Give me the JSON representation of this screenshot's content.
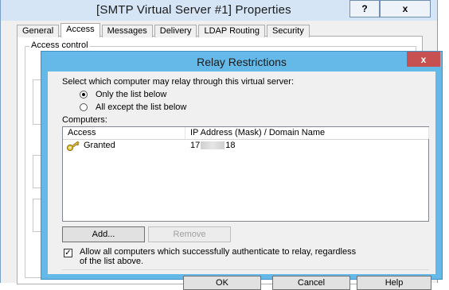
{
  "parent_window": {
    "title": "[SMTP Virtual Server #1] Properties",
    "help_button": "?",
    "close_button": "x",
    "tabs": [
      {
        "label": "General"
      },
      {
        "label": "Access"
      },
      {
        "label": "Messages"
      },
      {
        "label": "Delivery"
      },
      {
        "label": "LDAP Routing"
      },
      {
        "label": "Security"
      }
    ],
    "active_tab": "Access",
    "group_label": "Access control"
  },
  "dialog": {
    "title": "Relay Restrictions",
    "close_button": "x",
    "prompt": "Select which computer may relay through this virtual server:",
    "radio_only": "Only the list below",
    "radio_except": "All except the list below",
    "selected_radio": "only",
    "computers_label": "Computers:",
    "columns": [
      "Access",
      "IP Address (Mask) / Domain Name"
    ],
    "rows": [
      {
        "access": "Granted",
        "ip_prefix": "17",
        "ip_suffix": "18",
        "icon": "key-icon"
      }
    ],
    "add_button": "Add...",
    "remove_button": "Remove",
    "allow_auth_checked": true,
    "allow_auth_line1": "Allow all computers which successfully authenticate to relay, regardless",
    "allow_auth_line2": "of the list above.",
    "ok_button": "OK",
    "cancel_button": "Cancel",
    "help_button": "Help"
  }
}
